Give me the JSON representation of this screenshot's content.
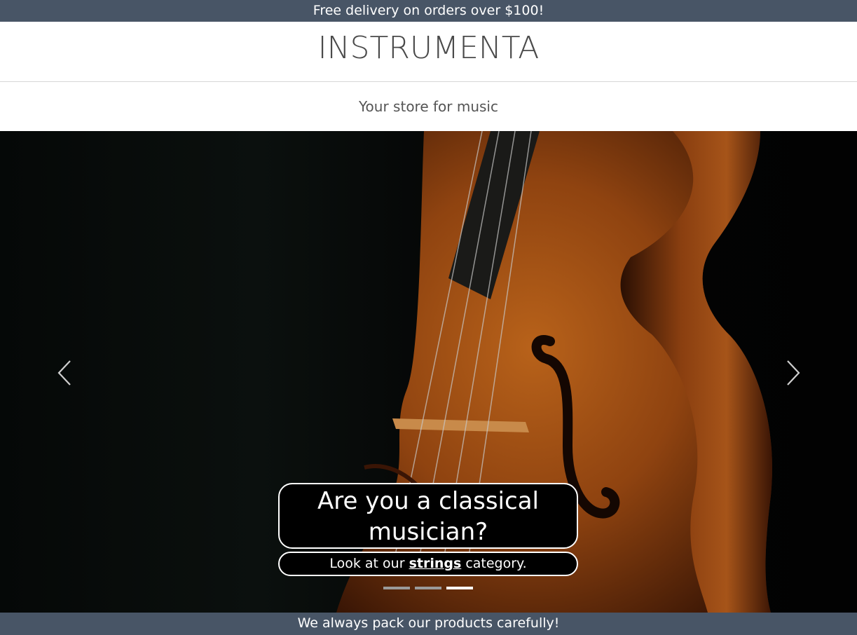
{
  "promo": {
    "text": "Free delivery on orders over $100!"
  },
  "header": {
    "logo": "INSTRUMENTA",
    "tagline": "Your store for music"
  },
  "carousel": {
    "title": "Are you a classical musician?",
    "subtitle_prefix": "Look at our",
    "subtitle_link": "strings",
    "subtitle_suffix": "category.",
    "prev_icon": "chevron-left-icon",
    "next_icon": "chevron-right-icon",
    "slide_count": 3,
    "active_slide": 3,
    "image": "violin-closeup"
  },
  "footer": {
    "text": "We always pack our products carefully!"
  },
  "colors": {
    "bar": "#485566",
    "background": "#ffffff",
    "text": "#4a4a4a"
  }
}
